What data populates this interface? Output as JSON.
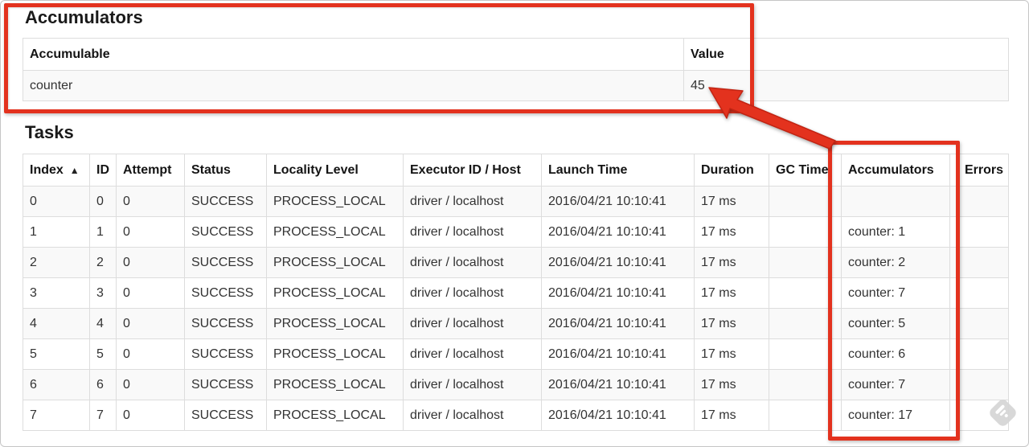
{
  "colors": {
    "annotation_red": "#e3321e",
    "table_border": "#dddddd",
    "row_stripe": "#f9f9f9",
    "cell_text": "#333333",
    "header_text": "#141414",
    "heading_text": "#1a1a1a",
    "stamp_gray": "#d6d6d6"
  },
  "accumulators": {
    "heading": "Accumulators",
    "columns": [
      {
        "key": "accumulable",
        "label": "Accumulable"
      },
      {
        "key": "value",
        "label": "Value"
      }
    ],
    "rows": [
      [
        "counter",
        "45"
      ]
    ]
  },
  "tasks": {
    "heading": "Tasks",
    "sort_icon": "▲",
    "columns": [
      {
        "key": "index",
        "label": "Index",
        "sorted": "asc"
      },
      {
        "key": "id",
        "label": "ID"
      },
      {
        "key": "attempt",
        "label": "Attempt"
      },
      {
        "key": "status",
        "label": "Status"
      },
      {
        "key": "locality_level",
        "label": "Locality Level"
      },
      {
        "key": "executor_id_host",
        "label": "Executor ID / Host"
      },
      {
        "key": "launch_time",
        "label": "Launch Time"
      },
      {
        "key": "duration",
        "label": "Duration"
      },
      {
        "key": "gc_time",
        "label": "GC Time"
      },
      {
        "key": "accumulators",
        "label": "Accumulators"
      },
      {
        "key": "errors",
        "label": "Errors"
      }
    ],
    "rows": [
      [
        "0",
        "0",
        "0",
        "SUCCESS",
        "PROCESS_LOCAL",
        "driver / localhost",
        "2016/04/21 10:10:41",
        "17 ms",
        "",
        "",
        ""
      ],
      [
        "1",
        "1",
        "0",
        "SUCCESS",
        "PROCESS_LOCAL",
        "driver / localhost",
        "2016/04/21 10:10:41",
        "17 ms",
        "",
        "counter: 1",
        ""
      ],
      [
        "2",
        "2",
        "0",
        "SUCCESS",
        "PROCESS_LOCAL",
        "driver / localhost",
        "2016/04/21 10:10:41",
        "17 ms",
        "",
        "counter: 2",
        ""
      ],
      [
        "3",
        "3",
        "0",
        "SUCCESS",
        "PROCESS_LOCAL",
        "driver / localhost",
        "2016/04/21 10:10:41",
        "17 ms",
        "",
        "counter: 7",
        ""
      ],
      [
        "4",
        "4",
        "0",
        "SUCCESS",
        "PROCESS_LOCAL",
        "driver / localhost",
        "2016/04/21 10:10:41",
        "17 ms",
        "",
        "counter: 5",
        ""
      ],
      [
        "5",
        "5",
        "0",
        "SUCCESS",
        "PROCESS_LOCAL",
        "driver / localhost",
        "2016/04/21 10:10:41",
        "17 ms",
        "",
        "counter: 6",
        ""
      ],
      [
        "6",
        "6",
        "0",
        "SUCCESS",
        "PROCESS_LOCAL",
        "driver / localhost",
        "2016/04/21 10:10:41",
        "17 ms",
        "",
        "counter: 7",
        ""
      ],
      [
        "7",
        "7",
        "0",
        "SUCCESS",
        "PROCESS_LOCAL",
        "driver / localhost",
        "2016/04/21 10:10:41",
        "17 ms",
        "",
        "counter: 17",
        ""
      ]
    ]
  }
}
